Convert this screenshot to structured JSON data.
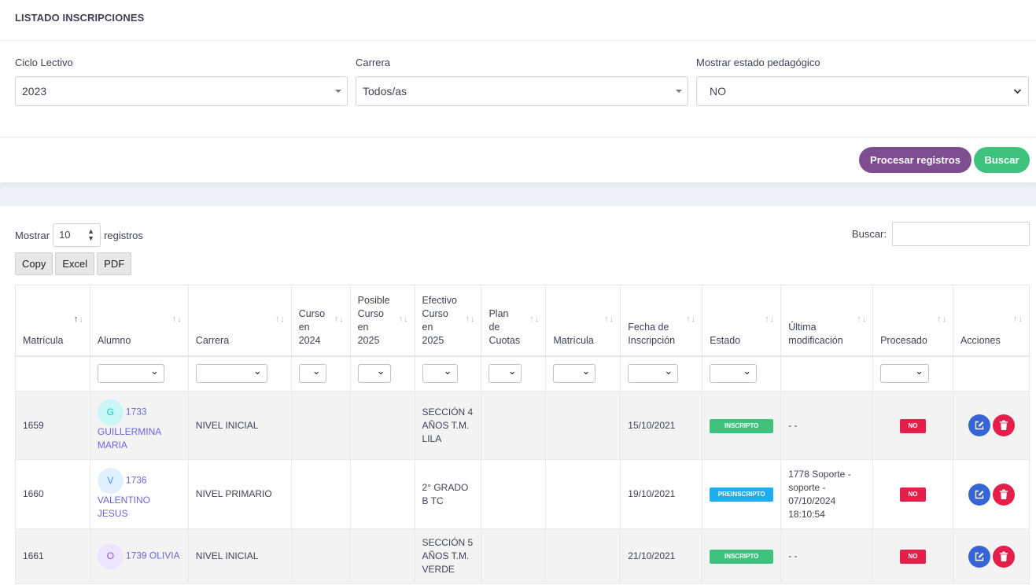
{
  "title": "LISTADO INSCRIPCIONES",
  "filters": {
    "ciclo": {
      "label": "Ciclo Lectivo",
      "value": "2023"
    },
    "carrera": {
      "label": "Carrera",
      "value": "Todos/as"
    },
    "estado_ped": {
      "label": "Mostrar estado pedagógico",
      "value": "NO"
    }
  },
  "buttons": {
    "procesar": "Procesar registros",
    "buscar": "Buscar"
  },
  "table_controls": {
    "mostrar": "Mostrar",
    "registros": "registros",
    "page_size": "10",
    "buscar_label": "Buscar:",
    "export": [
      "Copy",
      "Excel",
      "PDF"
    ]
  },
  "columns": {
    "c0": "Matrícula",
    "c1": "Alumno",
    "c2": "Carrera",
    "c3": [
      "Curso",
      "en",
      "2024"
    ],
    "c4": [
      "Posible",
      "Curso",
      "en",
      "2025"
    ],
    "c5": [
      "Efectivo",
      "Curso",
      "en",
      "2025"
    ],
    "c6": [
      "Plan",
      "de",
      "Cuotas"
    ],
    "c7": "Matrícula",
    "c8": [
      "Fecha de",
      "Inscripción"
    ],
    "c9": "Estado",
    "c10": [
      "Última",
      "modificación"
    ],
    "c11": "Procesado",
    "c12": "Acciones"
  },
  "rows": [
    {
      "matricula": "1659",
      "initial": "G",
      "alumno_id": "1733",
      "alumno_name": "GUILLERMINA MARIA",
      "carrera": "NIVEL INICIAL",
      "efectivo": "SECCIÓN 4 AÑOS T.M. LILA",
      "fecha": "15/10/2021",
      "estado": "INSCRIPTO",
      "ultima": "- -",
      "procesado": "NO"
    },
    {
      "matricula": "1660",
      "initial": "V",
      "alumno_id": "1736",
      "alumno_name": "VALENTINO JESUS",
      "carrera": "NIVEL PRIMARIO",
      "efectivo": "2° GRADO B TC",
      "fecha": "19/10/2021",
      "estado": "PREINSCRIPTO",
      "ultima": "1778 Soporte - soporte - 07/10/2024 18:10:54",
      "procesado": "NO"
    },
    {
      "matricula": "1661",
      "initial": "O",
      "alumno_id": "1739 OLIVIA",
      "alumno_name": "",
      "carrera": "NIVEL INICIAL",
      "efectivo": "SECCIÓN 5 AÑOS T.M. VERDE",
      "fecha": "21/10/2021",
      "estado": "INSCRIPTO",
      "ultima": "- -",
      "procesado": "NO"
    }
  ],
  "colors": {
    "purple": "#7e4d8f",
    "green": "#3ec27d",
    "red": "#e3204a",
    "blue": "#3765d6",
    "cyan": "#1eaef0"
  }
}
